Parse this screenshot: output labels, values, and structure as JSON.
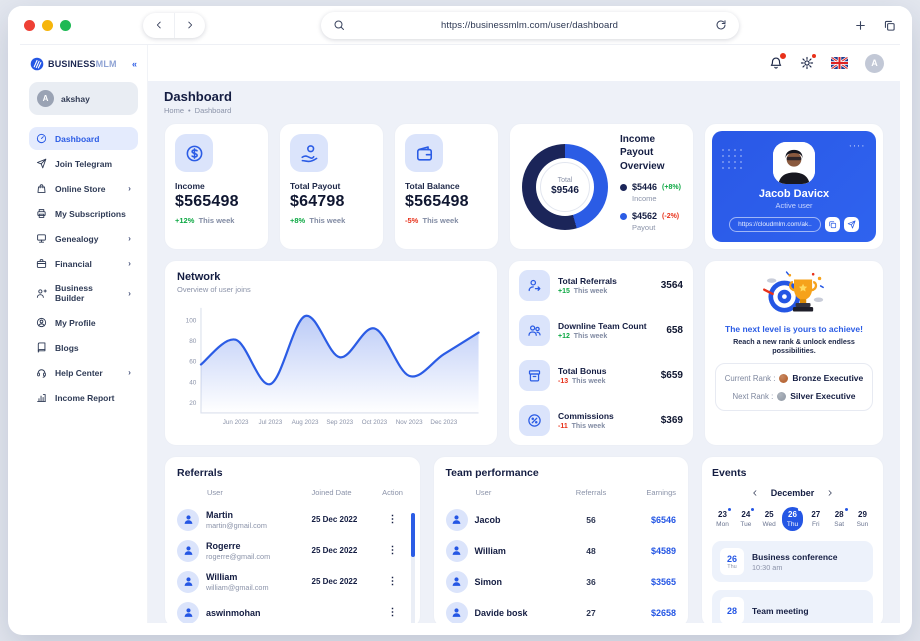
{
  "colors": {
    "accent": "#2b5ce5",
    "navy": "#1b2559",
    "green": "#0ca843",
    "red": "#e8311a"
  },
  "browser": {
    "url": "https://businessmlm.com/user/dashboard",
    "icons": {
      "back": "back",
      "forward": "forward",
      "search": "search",
      "reload": "reload",
      "new_tab": "plus",
      "windows": "copy"
    }
  },
  "brand": {
    "bold": "BUSINESS",
    "light": "MLM",
    "collapse": "«"
  },
  "sidebar": {
    "user": {
      "initial": "A",
      "name": "akshay"
    },
    "items": [
      {
        "label": "Dashboard",
        "icon": "dashboard",
        "active": true,
        "expandable": false
      },
      {
        "label": "Join Telegram",
        "icon": "telegram",
        "active": false,
        "expandable": false
      },
      {
        "label": "Online Store",
        "icon": "store",
        "active": false,
        "expandable": true
      },
      {
        "label": "My Subscriptions",
        "icon": "subscriptions",
        "active": false,
        "expandable": false
      },
      {
        "label": "Genealogy",
        "icon": "genealogy",
        "active": false,
        "expandable": true
      },
      {
        "label": "Financial",
        "icon": "financial",
        "active": false,
        "expandable": true
      },
      {
        "label": "Business Builder",
        "icon": "business-builder",
        "active": false,
        "expandable": true
      },
      {
        "label": "My Profile",
        "icon": "profile",
        "active": false,
        "expandable": false
      },
      {
        "label": "Blogs",
        "icon": "blogs",
        "active": false,
        "expandable": false
      },
      {
        "label": "Help Center",
        "icon": "help",
        "active": false,
        "expandable": true
      },
      {
        "label": "Income Report",
        "icon": "income-report",
        "active": false,
        "expandable": false
      }
    ]
  },
  "topbar": {
    "bell_icon": "bell",
    "gear_icon": "gear",
    "flag": "uk-flag",
    "avatar_initial": "A"
  },
  "page": {
    "title": "Dashboard",
    "breadcrumb": [
      "Home",
      "Dashboard"
    ]
  },
  "stats": [
    {
      "label": "Income",
      "value": "$565498",
      "delta": "+12%",
      "trend": "up",
      "note": "This week",
      "icon": "dollar-circle"
    },
    {
      "label": "Total Payout",
      "value": "$64798",
      "delta": "+8%",
      "trend": "up",
      "note": "This week",
      "icon": "hand-coin"
    },
    {
      "label": "Total Balance",
      "value": "$565498",
      "delta": "-5%",
      "trend": "down",
      "note": "This week",
      "icon": "wallet"
    }
  ],
  "income_payout": {
    "title": "Income Payout Overview",
    "center_label": "Total",
    "center_value": "$9546",
    "legend": [
      {
        "value": "$5446",
        "delta": "(+8%)",
        "trend": "up",
        "label": "Income",
        "color": "#1b2559"
      },
      {
        "value": "$4562",
        "delta": "(-2%)",
        "trend": "down",
        "label": "Payout",
        "color": "#2b5ce5"
      }
    ]
  },
  "profile_card": {
    "name": "Jacob Davicx",
    "status": "Active user",
    "link": "https://cloudmlm.com/ak..",
    "buttons": [
      {
        "icon": "copy"
      },
      {
        "icon": "telegram"
      }
    ]
  },
  "network": {
    "title": "Network",
    "subtitle": "Overview of  user joins"
  },
  "referral_stats": [
    {
      "title": "Total Referrals",
      "delta": "+15",
      "trend": "up",
      "note": "This week",
      "value": "3564",
      "icon": "user-arrow"
    },
    {
      "title": "Downline Team Count",
      "delta": "+12",
      "trend": "up",
      "note": "This week",
      "value": "658",
      "icon": "users"
    },
    {
      "title": "Total Bonus",
      "delta": "-13",
      "trend": "down",
      "note": "This week",
      "value": "$659",
      "icon": "gift"
    },
    {
      "title": "Commissions",
      "delta": "-11",
      "trend": "down",
      "note": "This week",
      "value": "$369",
      "icon": "percent-circle"
    }
  ],
  "next_level": {
    "headline": "The next level is yours to achieve!",
    "subtext": "Reach a new rank & unlock endless possibilities.",
    "rows": [
      {
        "label": "Current Rank :",
        "rank": "Bronze Executive",
        "color": "#b96a3a"
      },
      {
        "label": "Next Rank :",
        "rank": "Silver Executive",
        "color": "#9aa2ad"
      }
    ]
  },
  "referrals": {
    "title": "Referrals",
    "columns": [
      "User",
      "Joined Date",
      "Action"
    ],
    "rows": [
      {
        "name": "Martin",
        "email": "martin@gmail.com",
        "date": "25 Dec 2022"
      },
      {
        "name": "Rogerre",
        "email": "rogerre@gmail.com",
        "date": "25 Dec 2022"
      },
      {
        "name": "William",
        "email": "william@gmail.com",
        "date": "25 Dec 2022"
      },
      {
        "name": "aswinmohan",
        "email": "",
        "date": ""
      }
    ]
  },
  "team": {
    "title": "Team performance",
    "columns": [
      "User",
      "Referrals",
      "Earnings"
    ],
    "rows": [
      {
        "name": "Jacob",
        "referrals": "56",
        "earnings": "$6546"
      },
      {
        "name": "William",
        "referrals": "48",
        "earnings": "$4589"
      },
      {
        "name": "Simon",
        "referrals": "36",
        "earnings": "$3565"
      },
      {
        "name": "Davide bosk",
        "referrals": "27",
        "earnings": "$2658"
      }
    ]
  },
  "events": {
    "title": "Events",
    "month": "December",
    "days": [
      {
        "num": "23",
        "name": "Mon",
        "dot": true,
        "selected": false
      },
      {
        "num": "24",
        "name": "Tue",
        "dot": true,
        "selected": false
      },
      {
        "num": "25",
        "name": "Wed",
        "dot": false,
        "selected": false
      },
      {
        "num": "26",
        "name": "Thu",
        "dot": true,
        "selected": true
      },
      {
        "num": "27",
        "name": "Fri",
        "dot": false,
        "selected": false
      },
      {
        "num": "28",
        "name": "Sat",
        "dot": true,
        "selected": false
      },
      {
        "num": "29",
        "name": "Sun",
        "dot": false,
        "selected": false
      }
    ],
    "list": [
      {
        "num": "26",
        "day": "Thu",
        "title": "Business conference",
        "time": "10:30 am"
      },
      {
        "num": "28",
        "day": "",
        "title": "Team meeting",
        "time": ""
      }
    ]
  },
  "chart_data": [
    {
      "type": "pie",
      "title": "Income Payout Overview",
      "labels": [
        "Income",
        "Payout"
      ],
      "values": [
        5446,
        4562
      ],
      "colors": [
        "#1b2559",
        "#2b5ce5"
      ],
      "center_label": "Total",
      "center_total": 9546,
      "donut": true
    },
    {
      "type": "line",
      "title": "Network",
      "subtitle": "Overview of user joins",
      "x_labels": [
        "Jun 2023",
        "Jul 2023",
        "Aug 2023",
        "Sep 2023",
        "Oct 2023",
        "Nov 2023",
        "Dec 2023"
      ],
      "y": [
        57,
        81,
        38,
        104,
        64,
        92,
        46,
        67,
        88
      ],
      "yticks": [
        20,
        40,
        60,
        80,
        100
      ],
      "ylim": [
        10,
        112
      ],
      "color": "#2b5ce5",
      "area_fill": true,
      "grid": false,
      "legend": "none"
    }
  ]
}
